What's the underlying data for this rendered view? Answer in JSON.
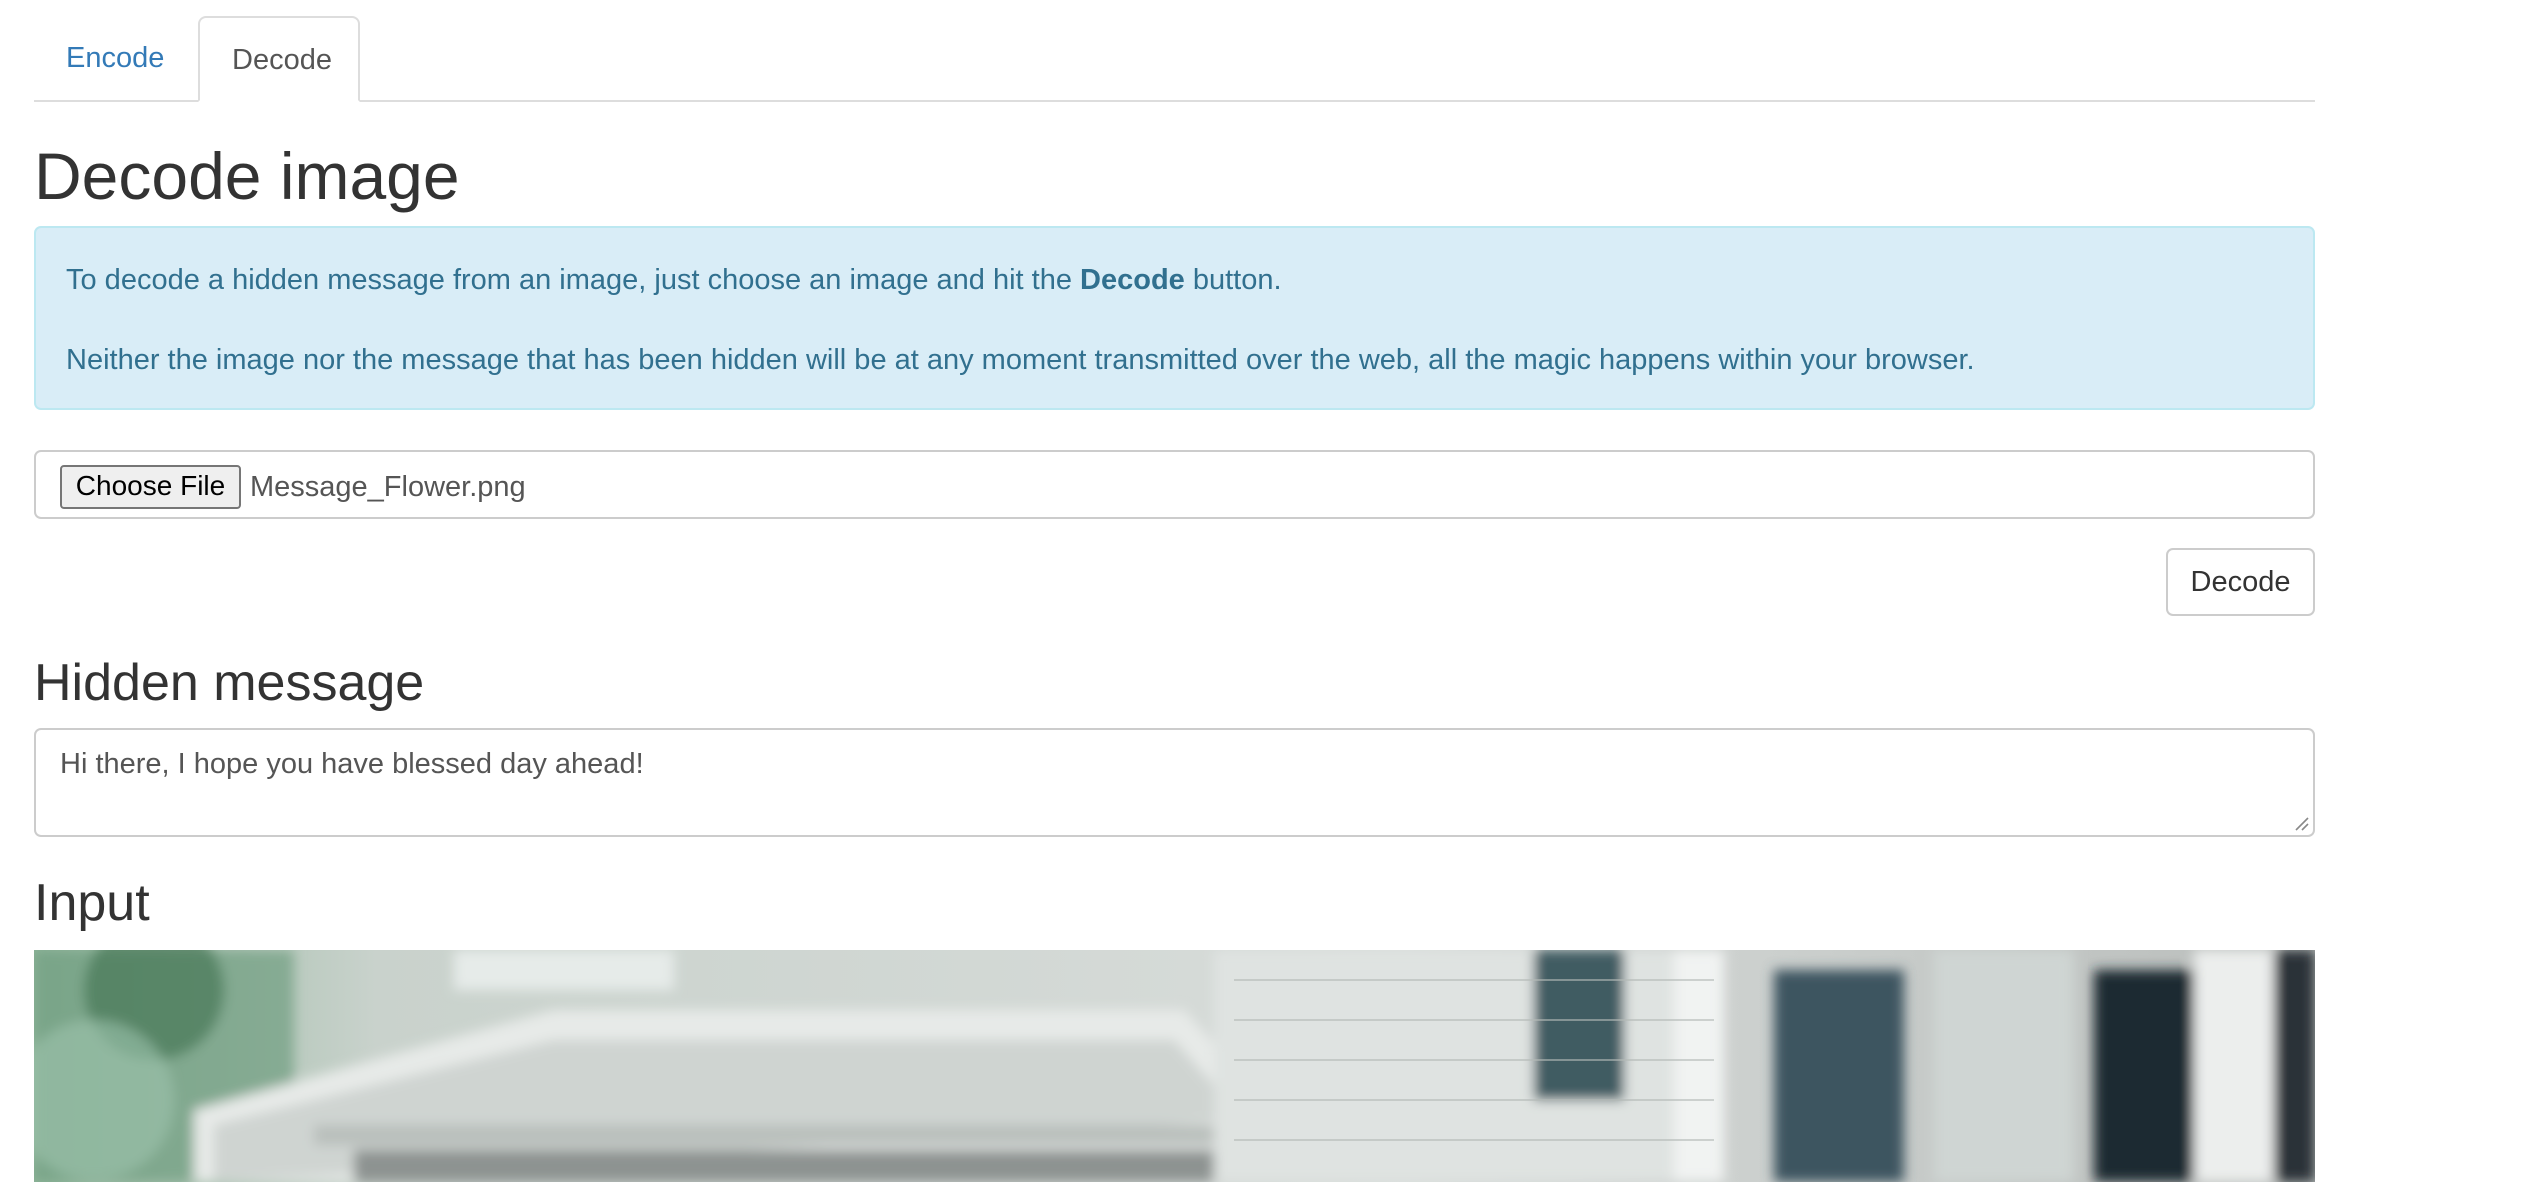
{
  "tabs": [
    {
      "label": "Encode",
      "active": false
    },
    {
      "label": "Decode",
      "active": true
    }
  ],
  "page_title": "Decode image",
  "info": {
    "line1_before": "To decode a hidden message from an image, just choose an image and hit the ",
    "line1_bold": "Decode",
    "line1_after": " button.",
    "line2": "Neither the image nor the message that has been hidden will be at any moment transmitted over the web, all the magic happens within your browser."
  },
  "file_input": {
    "button_label": "Choose File",
    "file_name": "Message_Flower.png"
  },
  "decode_button": "Decode",
  "hidden_message": {
    "title": "Hidden message",
    "value": "Hi there, I hope you have blessed day ahead!"
  },
  "input_section": {
    "title": "Input"
  },
  "colors": {
    "link": "#337ab7",
    "info_bg": "#d9edf7",
    "info_text": "#31708f",
    "info_border": "#bce8f1"
  }
}
